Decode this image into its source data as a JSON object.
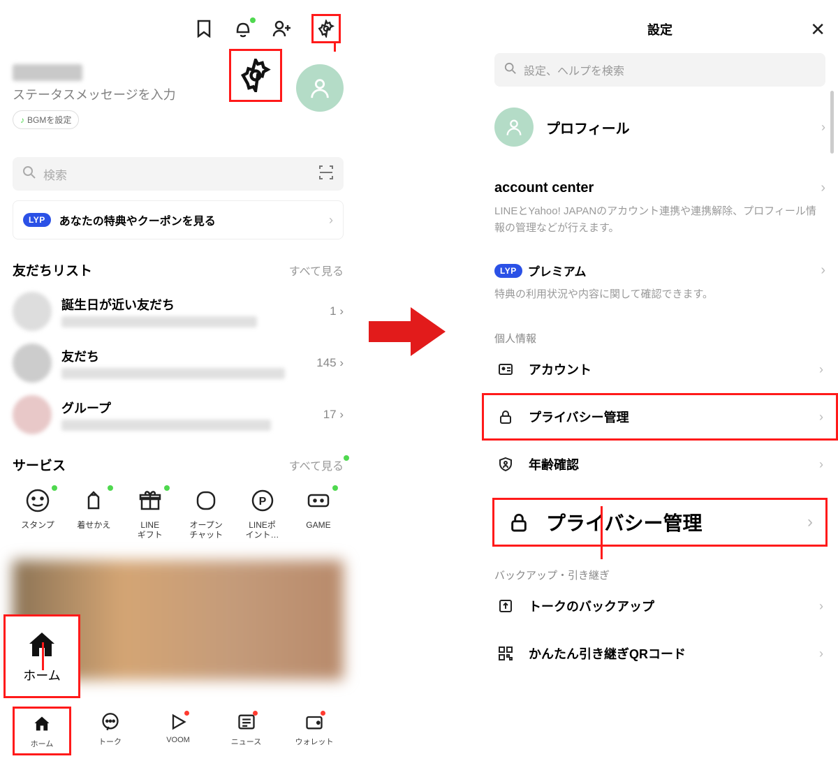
{
  "left": {
    "status_message": "ステータスメッセージを入力",
    "bgm_label": "BGMを設定",
    "search_placeholder": "検索",
    "lyp_badge": "LYP",
    "lyp_text": "あなたの特典やクーポンを見る",
    "friends_title": "友だちリスト",
    "see_all": "すべて見る",
    "friends": [
      {
        "name": "誕生日が近い友だち",
        "count": "1"
      },
      {
        "name": "友だち",
        "count": "145"
      },
      {
        "name": "グループ",
        "count": "17"
      }
    ],
    "services_title": "サービス",
    "services": [
      {
        "label": "スタンプ"
      },
      {
        "label": "着せかえ"
      },
      {
        "label": "LINE\nギフト"
      },
      {
        "label": "オープン\nチャット"
      },
      {
        "label": "LINEポ\nイント…"
      },
      {
        "label": "GAME"
      }
    ],
    "home_callout": "ホーム",
    "nav": [
      {
        "label": "ホーム"
      },
      {
        "label": "トーク"
      },
      {
        "label": "VOOM"
      },
      {
        "label": "ニュース"
      },
      {
        "label": "ウォレット"
      }
    ]
  },
  "right": {
    "title": "設定",
    "search_placeholder": "設定、ヘルプを検索",
    "profile_label": "プロフィール",
    "account_center_title": "account center",
    "account_center_desc": "LINEとYahoo! JAPANのアカウント連携や連携解除、プロフィール情報の管理などが行えます。",
    "lyp_badge": "LYP",
    "premium_label": "プレミアム",
    "premium_desc": "特典の利用状況や内容に関して確認できます。",
    "group_personal": "個人情報",
    "items_personal": [
      "アカウント",
      "プライバシー管理",
      "年齢確認"
    ],
    "privacy_callout": "プライバシー管理",
    "group_backup": "バックアップ・引き継ぎ",
    "items_backup": [
      "トークのバックアップ",
      "かんたん引き継ぎQRコード"
    ]
  }
}
